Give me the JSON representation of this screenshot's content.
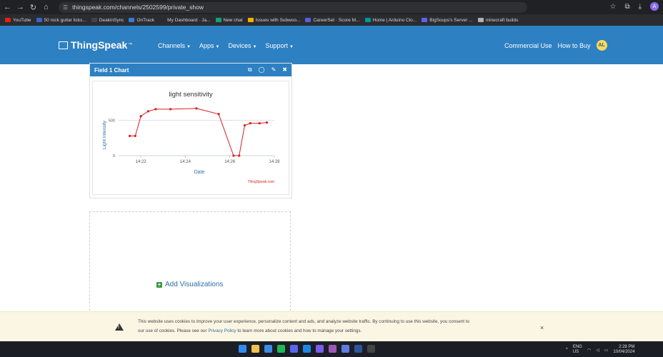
{
  "browser": {
    "url": "thingspeak.com/channels/2502599/private_show",
    "profile_initial": "A",
    "bookmarks": [
      {
        "label": "YouTube",
        "color": "#e62117"
      },
      {
        "label": "50 rock guitar licks...",
        "color": "#3366cc"
      },
      {
        "label": "DeakinSync",
        "color": "#444444"
      },
      {
        "label": "OnTrack",
        "color": "#3a7bd5"
      },
      {
        "label": "My Dashboard · Ja...",
        "color": "#2b2c2f"
      },
      {
        "label": "New chat",
        "color": "#10a37f"
      },
      {
        "label": "Issues with Subwoo...",
        "color": "#f0b400"
      },
      {
        "label": "CareerSet · Score M...",
        "color": "#5563de"
      },
      {
        "label": "Home | Arduino Clo...",
        "color": "#00979d"
      },
      {
        "label": "BigSoups's Server ...",
        "color": "#5865f2"
      },
      {
        "label": "minecraft builds",
        "color": "#b0b0b0"
      }
    ]
  },
  "navbar": {
    "logo": "ThingSpeak",
    "logo_tm": "™",
    "menu": [
      {
        "label": "Channels"
      },
      {
        "label": "Apps"
      },
      {
        "label": "Devices"
      },
      {
        "label": "Support"
      }
    ],
    "commercial_use": "Commercial Use",
    "how_to_buy": "How to Buy",
    "avatar_initials": "AL"
  },
  "field_panel": {
    "title": "Field 1 Chart"
  },
  "chart_data": {
    "type": "line",
    "title": "light sensitivity",
    "xlabel": "Date",
    "ylabel": "Light Intensity",
    "x_ticks": [
      "14:22",
      "14:24",
      "14:26",
      "14:28"
    ],
    "y_ticks": [
      0,
      500
    ],
    "ylim": [
      0,
      750
    ],
    "credit": "ThingSpeak.com",
    "series_color": "#d62020",
    "points": [
      {
        "t": "14:21:30",
        "y": 280
      },
      {
        "t": "14:21:45",
        "y": 280
      },
      {
        "t": "14:22:00",
        "y": 560
      },
      {
        "t": "14:22:20",
        "y": 630
      },
      {
        "t": "14:22:40",
        "y": 660
      },
      {
        "t": "14:23:20",
        "y": 660
      },
      {
        "t": "14:24:30",
        "y": 670
      },
      {
        "t": "14:25:30",
        "y": 590
      },
      {
        "t": "14:26:10",
        "y": 0
      },
      {
        "t": "14:26:25",
        "y": 0
      },
      {
        "t": "14:26:40",
        "y": 430
      },
      {
        "t": "14:26:55",
        "y": 460
      },
      {
        "t": "14:27:20",
        "y": 460
      },
      {
        "t": "14:27:40",
        "y": 470
      }
    ]
  },
  "viz": {
    "add_label": "Add Visualizations"
  },
  "cookie": {
    "text_1": "This website uses cookies to improve your user experience, personalize content and ads, and analyze website traffic. By continuing to use this website, you consent to",
    "text_2_pre": "our use of cookies. Please see our",
    "link": "Privacy Policy",
    "text_2_post": "to learn more about cookies and how to manage your settings.",
    "close": "×"
  },
  "taskbar": {
    "language": "ENG",
    "region": "US",
    "time": "2:28 PM",
    "date": "10/04/2024",
    "apps": [
      {
        "color": "#2d8cf0"
      },
      {
        "color": "#f2c14e"
      },
      {
        "color": "#3c8de8"
      },
      {
        "color": "#1db954"
      },
      {
        "color": "#5865f2"
      },
      {
        "color": "#1e88e5"
      },
      {
        "color": "#7a5cf0"
      },
      {
        "color": "#9b59b6"
      },
      {
        "color": "#5e7ce2"
      },
      {
        "color": "#2b579a"
      },
      {
        "color": "#444444"
      }
    ]
  }
}
